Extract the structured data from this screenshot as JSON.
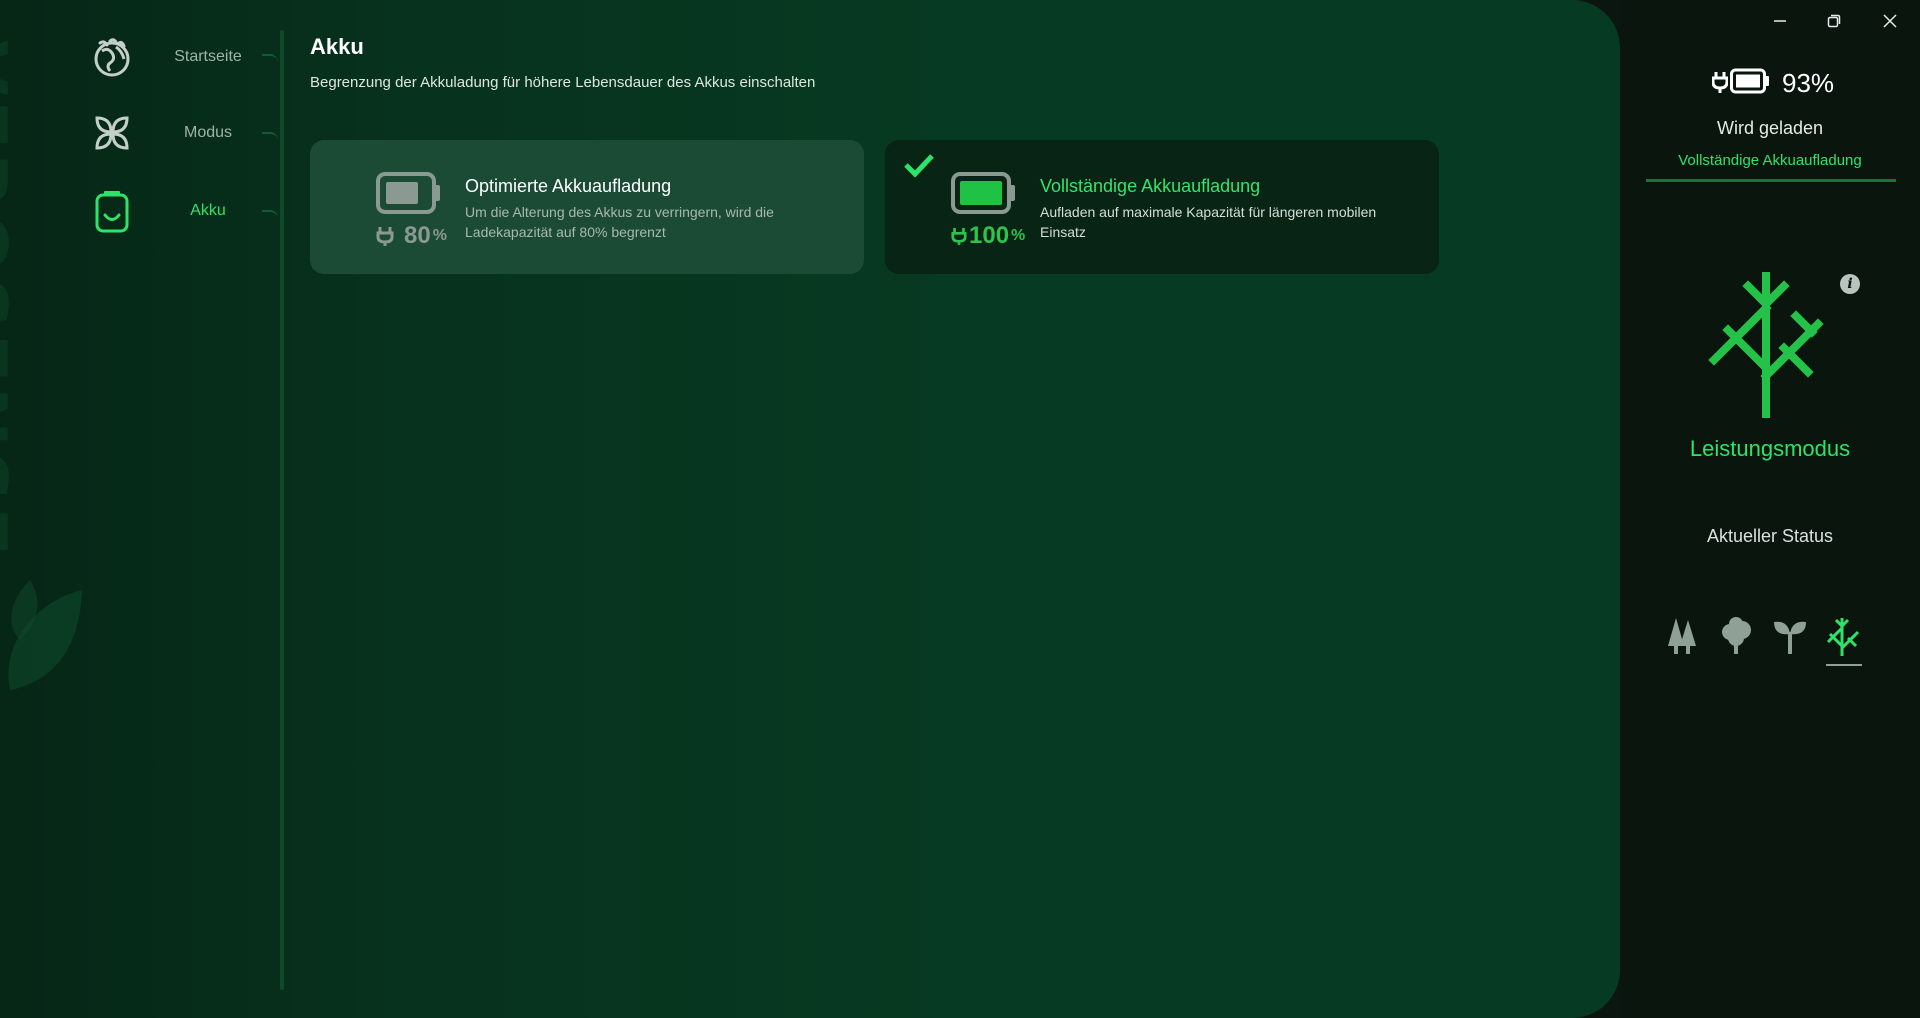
{
  "brand": {
    "watermark": "VEROSENSE"
  },
  "colors": {
    "accent": "#2ee36a",
    "panel": "#073a22",
    "selected_card": "#072414",
    "unselected_card": "#1c4b35"
  },
  "nav": {
    "items": [
      {
        "label": "Startseite",
        "icon": "globe-icon",
        "active": false
      },
      {
        "label": "Modus",
        "icon": "leaves-icon",
        "active": false
      },
      {
        "label": "Akku",
        "icon": "battery-icon",
        "active": true
      }
    ]
  },
  "page": {
    "title": "Akku",
    "subtitle": "Begrenzung der Akkuladung für höhere Lebensdauer des Akkus einschalten"
  },
  "cards": [
    {
      "title": "Optimierte Akkuaufladung",
      "description": "Um die Alterung des Akkus zu verringern, wird die Ladekapazität auf 80% begrenzt",
      "percent": "80",
      "percent_unit": "%",
      "selected": false
    },
    {
      "title": "Vollständige Akkuaufladung",
      "description": "Aufladen auf maximale Kapazität für längeren mobilen Einsatz",
      "percent": "100",
      "percent_unit": "%",
      "selected": true
    }
  ],
  "status": {
    "battery_percent": "93%",
    "charging_text": "Wird geladen",
    "charge_mode": "Vollständige Akkuaufladung",
    "performance_mode": "Leistungsmodus",
    "current_status_label": "Aktueller Status"
  },
  "mode_icons": [
    "forest-icon",
    "tree-icon",
    "sprout-icon",
    "branch-icon"
  ],
  "window_controls": [
    "minimize-icon",
    "restore-icon",
    "close-icon"
  ]
}
